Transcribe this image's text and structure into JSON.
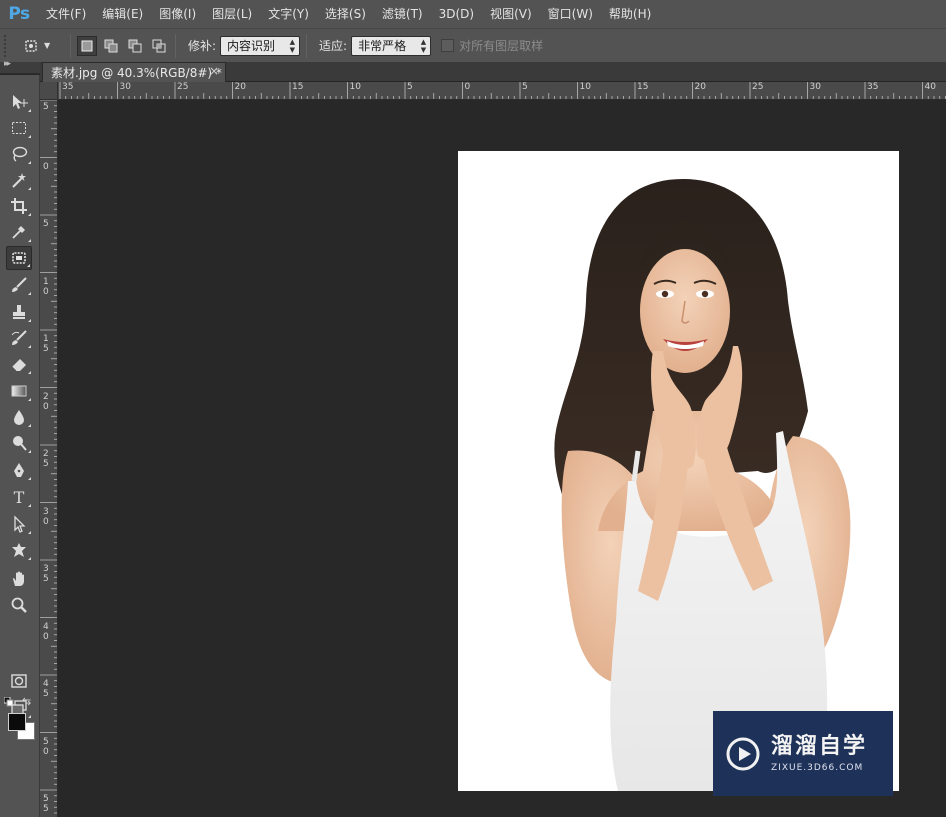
{
  "app": {
    "logo": "Ps"
  },
  "menu": [
    "文件(F)",
    "编辑(E)",
    "图像(I)",
    "图层(L)",
    "文字(Y)",
    "选择(S)",
    "滤镜(T)",
    "3D(D)",
    "视图(V)",
    "窗口(W)",
    "帮助(H)"
  ],
  "options": {
    "tool_preset_icon": "patch-tool-icon",
    "patch_label": "修补:",
    "patch_value": "内容识别",
    "adapt_label": "适应:",
    "adapt_value": "非常严格",
    "sample_all_label": "对所有图层取样",
    "sample_all_checked": false
  },
  "document": {
    "tab_label": "素材.jpg @ 40.3%(RGB/8#) *",
    "close_glyph": "×"
  },
  "ruler": {
    "h_labels": [
      "35",
      "30",
      "25",
      "20",
      "15",
      "10",
      "5",
      "0",
      "5",
      "10",
      "15",
      "20",
      "25",
      "30",
      "35",
      "40"
    ],
    "v_labels": [
      [
        "5"
      ],
      [
        "0"
      ],
      [
        "5"
      ],
      [
        "1",
        "0"
      ],
      [
        "1",
        "5"
      ],
      [
        "2",
        "0"
      ],
      [
        "2",
        "5"
      ],
      [
        "3",
        "0"
      ],
      [
        "3",
        "5"
      ],
      [
        "4",
        "0"
      ],
      [
        "4",
        "5"
      ],
      [
        "5",
        "0"
      ],
      [
        "5",
        "5"
      ]
    ]
  },
  "tools": [
    "move-tool-icon",
    "marquee-tool-icon",
    "lasso-tool-icon",
    "magic-wand-tool-icon",
    "crop-tool-icon",
    "eyedropper-tool-icon",
    "patch-tool-icon",
    "brush-tool-icon",
    "clone-stamp-tool-icon",
    "history-brush-tool-icon",
    "eraser-tool-icon",
    "gradient-tool-icon",
    "blur-tool-icon",
    "dodge-tool-icon",
    "pen-tool-icon",
    "type-tool-icon",
    "path-selection-tool-icon",
    "custom-shape-tool-icon",
    "hand-tool-icon",
    "zoom-tool-icon",
    "quick-mask-icon",
    "screen-mode-icon"
  ],
  "type_tool_glyph": "T",
  "colors": {
    "foreground": "#0b0b0b",
    "background": "#ffffff",
    "accent": "#4ea8e6"
  },
  "watermark": {
    "cn": "溜溜自学",
    "url": "ZIXUE.3D66.COM"
  }
}
